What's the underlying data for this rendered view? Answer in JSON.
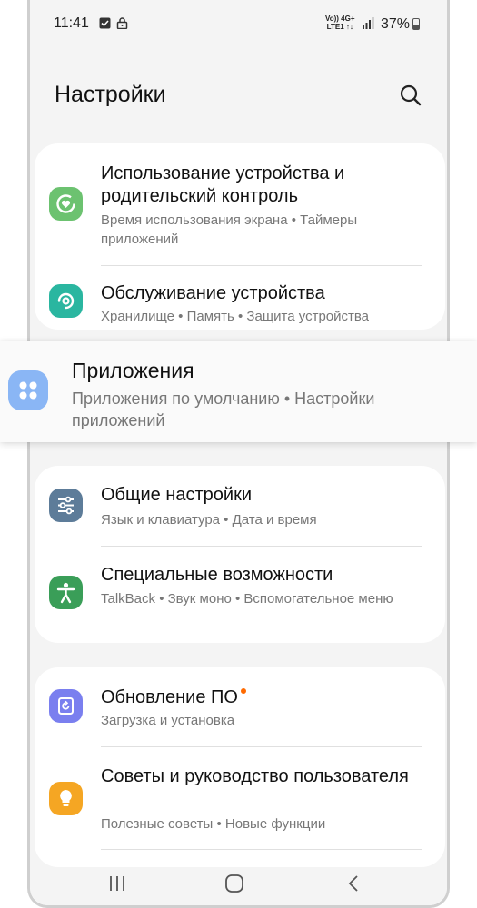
{
  "status_bar": {
    "time": "11:41",
    "network_top": "Vo)) 4G+",
    "network_bottom": "LTE1 ↑↓",
    "battery": "37%"
  },
  "header": {
    "title": "Настройки",
    "search_icon": "search-icon"
  },
  "items": {
    "device_usage": {
      "title": "Использование устройства и родительский контроль",
      "subtitle": "Время использования экрана  •  Таймеры приложений",
      "icon": "heart-timer-icon",
      "color": "#6cc270"
    },
    "maintenance": {
      "title": "Обслуживание устройства",
      "subtitle": "Хранилище  •  Память  •  Защита устройства",
      "icon": "device-care-icon",
      "color": "#2ab6a0"
    },
    "apps": {
      "title": "Приложения",
      "subtitle": "Приложения по умолчанию  •  Настройки приложений",
      "icon": "apps-grid-icon",
      "color": "#8ab6f5"
    },
    "general": {
      "title": "Общие настройки",
      "subtitle": "Язык и клавиатура  •  Дата и время",
      "icon": "sliders-icon",
      "color": "#5d7c99"
    },
    "accessibility": {
      "title": "Специальные возможности",
      "subtitle": "TalkBack  •  Звук моно  •  Вспомогательное меню",
      "icon": "accessibility-person-icon",
      "color": "#3a9e58"
    },
    "software_update": {
      "title": "Обновление ПО",
      "subtitle": "Загрузка и установка",
      "icon": "update-icon",
      "color": "#7a7fef",
      "badge_color": "#ff6a00"
    },
    "tips": {
      "title": "Советы и руководство пользователя",
      "subtitle": "Полезные советы  •  Новые функции",
      "icon": "lightbulb-icon",
      "color": "#f5a623"
    }
  },
  "navbar": {
    "recents_icon": "recents-icon",
    "home_icon": "home-icon",
    "back_icon": "back-icon"
  }
}
